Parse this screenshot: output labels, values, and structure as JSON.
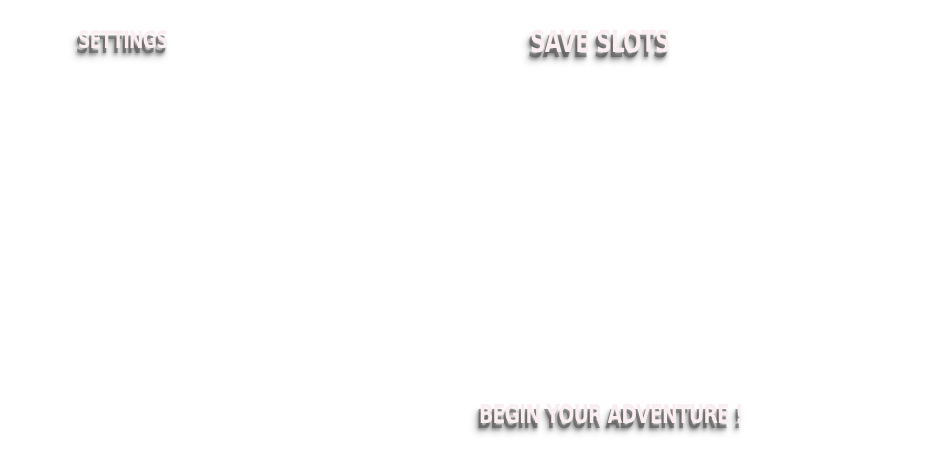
{
  "menu": {
    "settings_label": "SETTINGS",
    "save_slots_label": "SAVE SLOTS",
    "begin_label": "BEGIN YOUR ADVENTURE !"
  },
  "colors": {
    "background": "#ffffff",
    "text": "#fbeef1",
    "shadow": "#464646"
  }
}
